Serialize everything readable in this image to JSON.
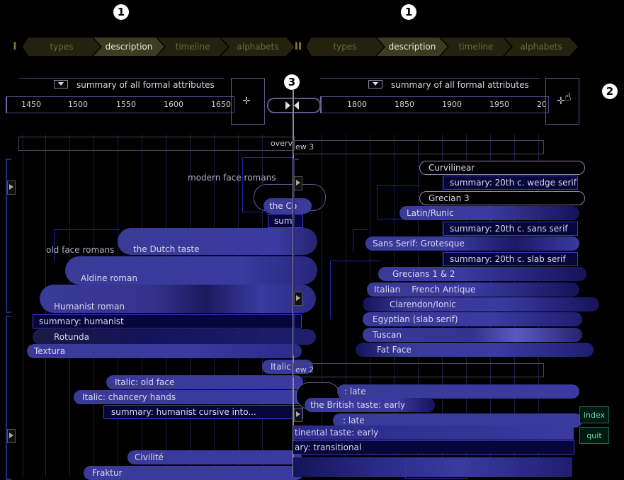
{
  "callouts": [
    "1",
    "1",
    "2",
    "3"
  ],
  "left_pane": {
    "number": "I",
    "tabs": [
      "types",
      "description",
      "timeline",
      "alphabets"
    ],
    "active_tab": "description",
    "summary_label": "summary of all formal attributes",
    "ruler_ticks": [
      "1450",
      "1500",
      "1550",
      "1600",
      "1650"
    ],
    "overview_label": "overv",
    "items": {
      "modern_face": "modern face romans",
      "the_co": "the Co",
      "sum": "sum",
      "old_face": "old face romans",
      "dutch_taste": "the Dutch taste",
      "aldine": "Aldine roman",
      "humanist": "Humanist roman",
      "summary_humanist": "summary: humanist",
      "rotunda": "Rotunda",
      "textura": "Textura",
      "italic_cut": "Italic",
      "italic_old_face": "Italic: old face",
      "italic_chancery": "Italic: chancery hands",
      "summary_cursive": "summary: humanist cursive into...",
      "civilite": "Civilité",
      "fraktur": "Fraktur"
    }
  },
  "right_pane": {
    "number": "II",
    "tabs": [
      "types",
      "description",
      "timeline",
      "alphabets"
    ],
    "active_tab": "description",
    "summary_label": "summary of all formal attributes",
    "ruler_ticks": [
      "1800",
      "1850",
      "1900",
      "1950",
      "20"
    ],
    "overview3_label": "ew 3",
    "overview2_label": "ew 2",
    "items": {
      "curvilinear": "Curvilinear",
      "summary_wedge": "summary: 20th c. wedge serif",
      "grecian3": "Grecian 3",
      "latin_runic": "Latin/Runic",
      "summary_sans": "summary: 20th c. sans serif",
      "sans_grotesque": "Sans Serif: Grotesque",
      "summary_slab": "summary: 20th c. slab serif",
      "grecians12": "Grecians 1 & 2",
      "italian": "Italian",
      "french_antique": "French Antique",
      "clarendon": "Clarendon/Ionic",
      "egyptian": "Egyptian (slab serif)",
      "tuscan": "Tuscan",
      "fat_face": "Fat Face",
      "late1": ": late",
      "british_taste": "the British taste: early",
      "late2": ": late",
      "continental": "tinental taste: early",
      "transitional": "ary: transitional"
    }
  },
  "buttons": {
    "index": "index",
    "quit": "quit"
  },
  "colors": {
    "bar": "#3a3a98",
    "bar_dark": "#14145a",
    "box_border": "#3a3ad0",
    "accent_green": "#5fe0b0"
  }
}
